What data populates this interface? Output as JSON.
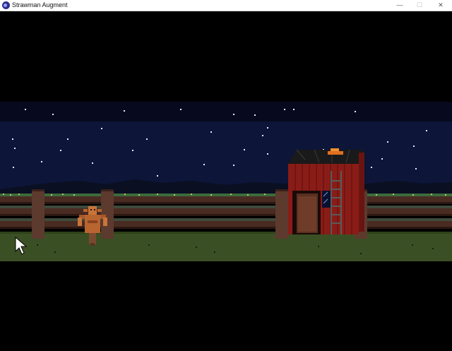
{
  "window": {
    "title": "Strawman Augment",
    "minimize_glyph": "—",
    "maximize_glyph": "☐",
    "close_glyph": "✕"
  },
  "scene": {
    "sky_color": "#0d1538",
    "upper_sky_color": "#070a1e",
    "grass_color": "#3b4f24",
    "shed_color": "#8a1c17",
    "fence_color": "#4a2b22",
    "characters": [
      "strawman"
    ],
    "objects": [
      "fence",
      "red-shed",
      "ladder",
      "door",
      "window",
      "roof-ornament"
    ],
    "cursor": "arrow-cursor"
  }
}
